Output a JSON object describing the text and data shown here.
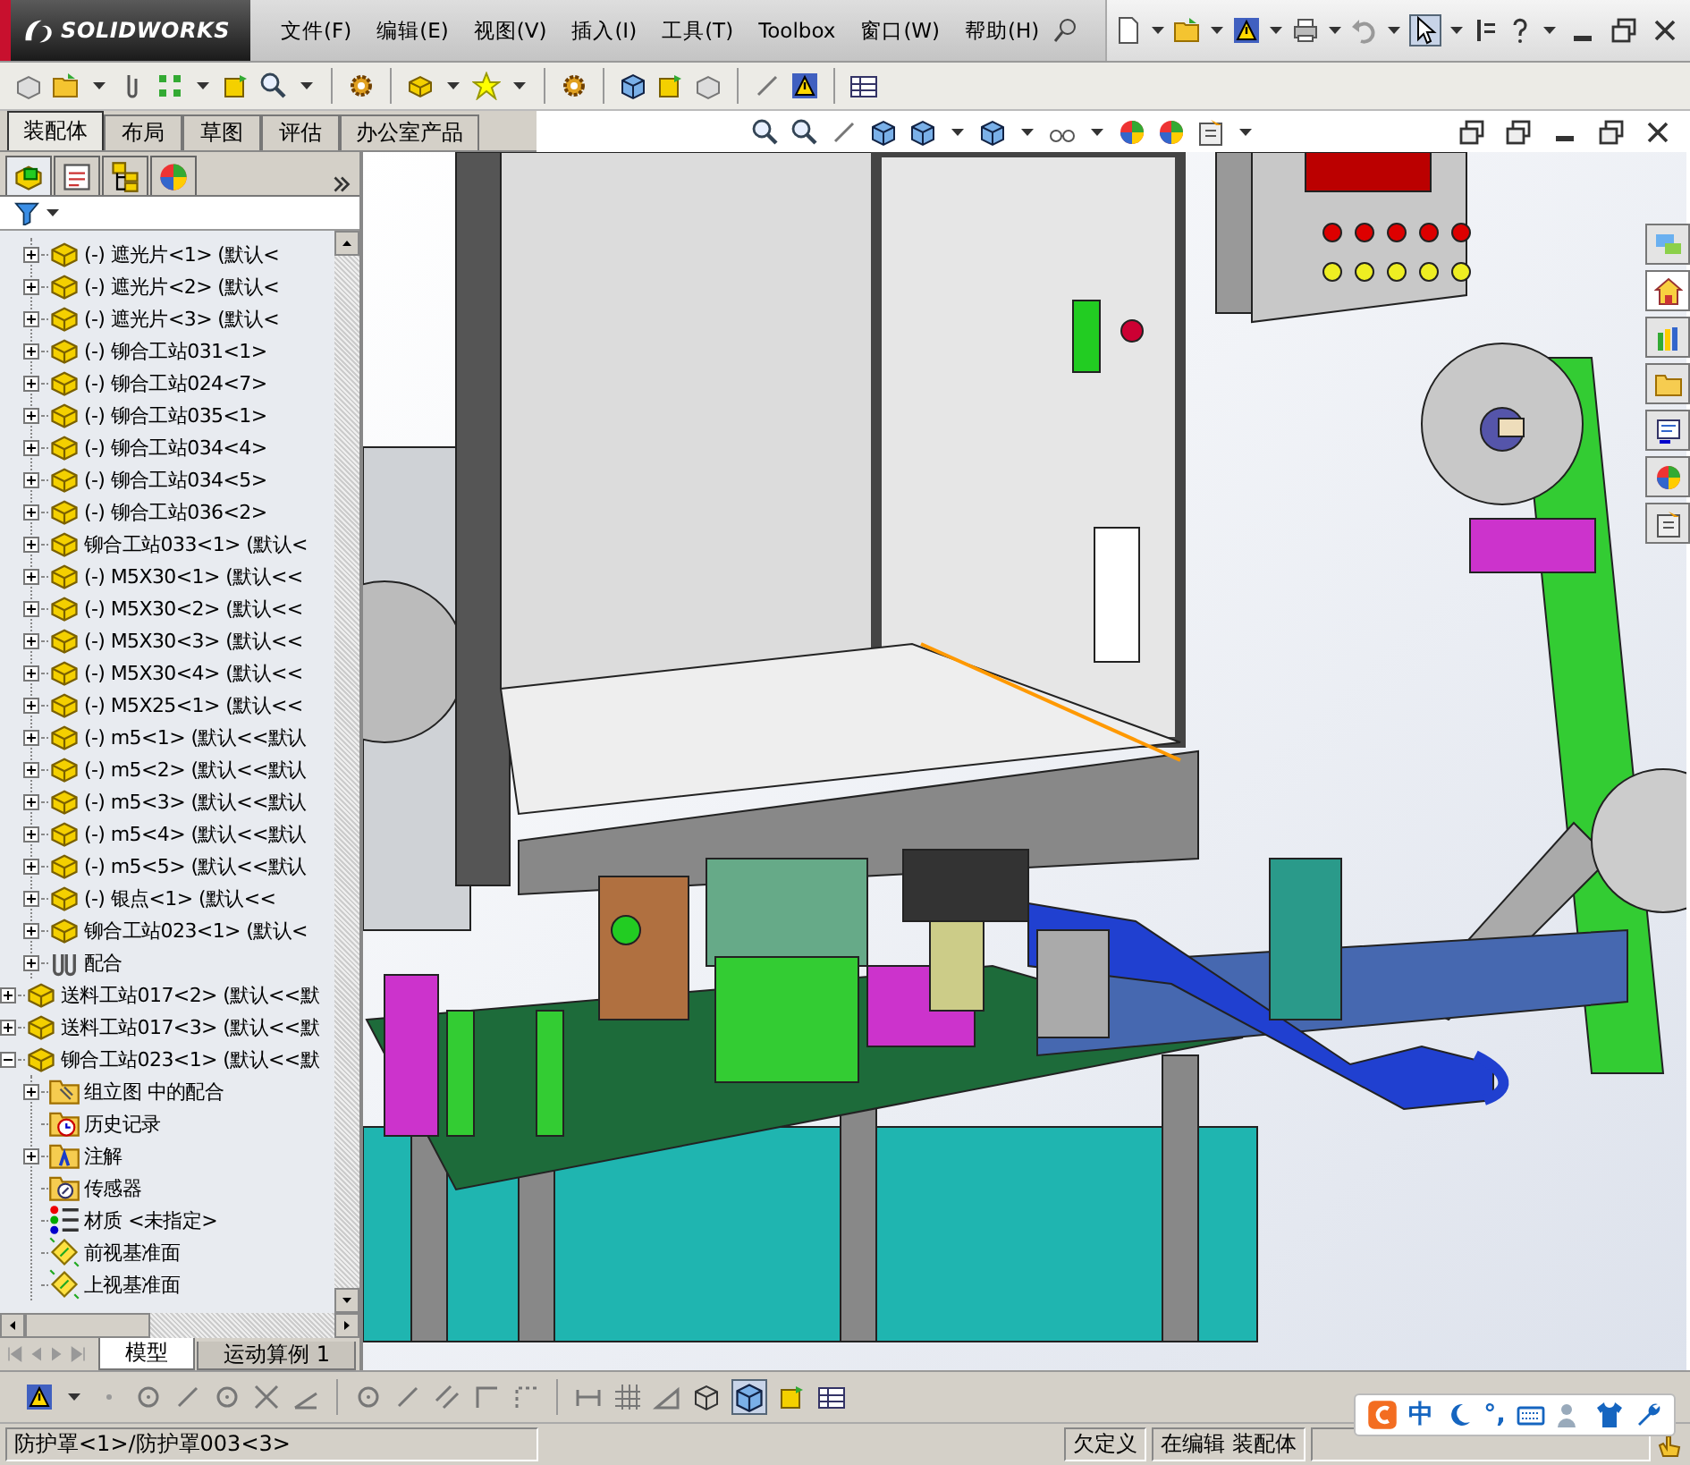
{
  "title_bar": {
    "logo_text": "SOLIDWORKS"
  },
  "menu": [
    "文件(F)",
    "编辑(E)",
    "视图(V)",
    "插入(I)",
    "工具(T)",
    "Toolbox",
    "窗口(W)",
    "帮助(H)"
  ],
  "command_tabs": [
    {
      "label": "装配体",
      "selected": true
    },
    {
      "label": "布局",
      "selected": false
    },
    {
      "label": "草图",
      "selected": false
    },
    {
      "label": "评估",
      "selected": false
    },
    {
      "label": "办公室产品",
      "selected": false
    }
  ],
  "tree": [
    {
      "children": [
        {
          "label": "(-) 遮光片<1> (默认<",
          "kind": "component",
          "expanded": false
        },
        {
          "label": "(-) 遮光片<2> (默认<",
          "kind": "component",
          "expanded": false
        },
        {
          "label": "(-) 遮光片<3> (默认<",
          "kind": "component",
          "expanded": false
        },
        {
          "label": "(-) 铆合工站031<1>",
          "kind": "component",
          "expanded": false
        },
        {
          "label": "(-) 铆合工站024<7>",
          "kind": "component",
          "expanded": false
        },
        {
          "label": "(-) 铆合工站035<1>",
          "kind": "component",
          "expanded": false
        },
        {
          "label": "(-) 铆合工站034<4>",
          "kind": "component",
          "expanded": false
        },
        {
          "label": "(-) 铆合工站034<5>",
          "kind": "component",
          "expanded": false
        },
        {
          "label": "(-) 铆合工站036<2>",
          "kind": "component",
          "expanded": false
        },
        {
          "label": "铆合工站033<1> (默认<",
          "kind": "component",
          "expanded": false
        },
        {
          "label": "(-) M5X30<1> (默认<<",
          "kind": "component",
          "expanded": false
        },
        {
          "label": "(-) M5X30<2> (默认<<",
          "kind": "component",
          "expanded": false
        },
        {
          "label": "(-) M5X30<3> (默认<<",
          "kind": "component",
          "expanded": false
        },
        {
          "label": "(-) M5X30<4> (默认<<",
          "kind": "component",
          "expanded": false
        },
        {
          "label": "(-) M5X25<1> (默认<<",
          "kind": "component",
          "expanded": false
        },
        {
          "label": "(-) m5<1> (默认<<默认",
          "kind": "component",
          "expanded": false
        },
        {
          "label": "(-) m5<2> (默认<<默认",
          "kind": "component",
          "expanded": false
        },
        {
          "label": "(-) m5<3> (默认<<默认",
          "kind": "component",
          "expanded": false
        },
        {
          "label": "(-) m5<4> (默认<<默认",
          "kind": "component",
          "expanded": false
        },
        {
          "label": "(-) m5<5> (默认<<默认",
          "kind": "component",
          "expanded": false
        },
        {
          "label": "(-) 银点<1> (默认<<",
          "kind": "component",
          "expanded": false
        },
        {
          "label": "铆合工站023<1> (默认<",
          "kind": "component",
          "expanded": false
        },
        {
          "label": "配合",
          "kind": "mates",
          "expanded": false
        }
      ]
    },
    {
      "label": "送料工站017<2> (默认<<默",
      "kind": "component",
      "expanded": false
    },
    {
      "label": "送料工站017<3> (默认<<默",
      "kind": "component",
      "expanded": false
    },
    {
      "label": "铆合工站023<1> (默认<<默",
      "kind": "component",
      "expanded": true,
      "children": [
        {
          "label": "组立图 中的配合",
          "kind": "mates-folder",
          "expanded": false
        },
        {
          "label": "历史记录",
          "kind": "history"
        },
        {
          "label": "注解",
          "kind": "annotations",
          "expanded": false
        },
        {
          "label": "传感器",
          "kind": "sensors"
        },
        {
          "label": "材质 <未指定>",
          "kind": "material"
        },
        {
          "label": "前视基准面",
          "kind": "plane"
        },
        {
          "label": "上视基准面",
          "kind": "plane"
        }
      ]
    }
  ],
  "bottom_tabs": [
    {
      "label": "模型",
      "selected": true
    },
    {
      "label": "运动算例 1",
      "selected": false
    }
  ],
  "status_bar": {
    "path": "防护罩<1>/防护罩003<3>",
    "state": "欠定义",
    "mode": "在编辑 装配体"
  },
  "ime_bar": {
    "mode": "中",
    "punctuation": "°,"
  }
}
